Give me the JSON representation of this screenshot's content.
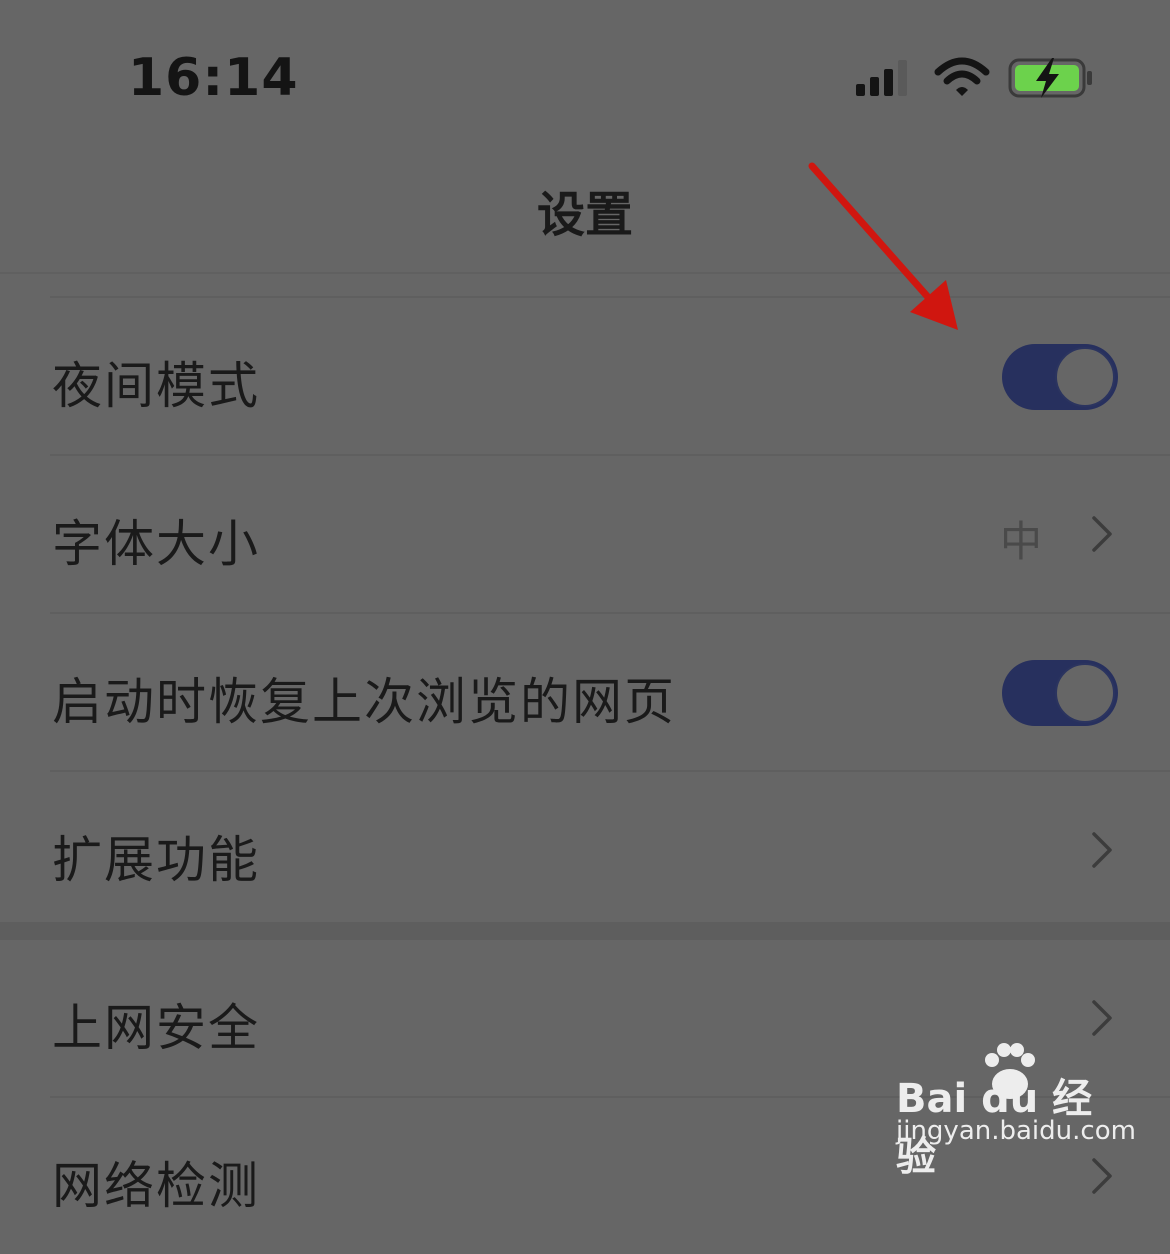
{
  "status_bar": {
    "time": "16:14",
    "icons": [
      "cellular-signal-icon",
      "wifi-icon",
      "battery-charging-icon"
    ],
    "battery_color": "#6cd24c"
  },
  "nav": {
    "title": "设置"
  },
  "settings_group_1": [
    {
      "label": "夜间模式",
      "control": "toggle",
      "on": true
    },
    {
      "label": "字体大小",
      "control": "disclosure",
      "value": "中"
    },
    {
      "label": "启动时恢复上次浏览的网页",
      "control": "toggle",
      "on": true
    },
    {
      "label": "扩展功能",
      "control": "disclosure"
    }
  ],
  "settings_group_2": [
    {
      "label": "上网安全",
      "control": "disclosure"
    },
    {
      "label": "网络检测",
      "control": "disclosure"
    }
  ],
  "annotation": {
    "arrow_color": "#d0160f",
    "target": "夜间模式 toggle"
  },
  "watermark": {
    "brand": "Bai du 经验",
    "url": "jingyan.baidu.com"
  },
  "colors": {
    "background": "#666666",
    "toggle_on": "#27305e"
  }
}
